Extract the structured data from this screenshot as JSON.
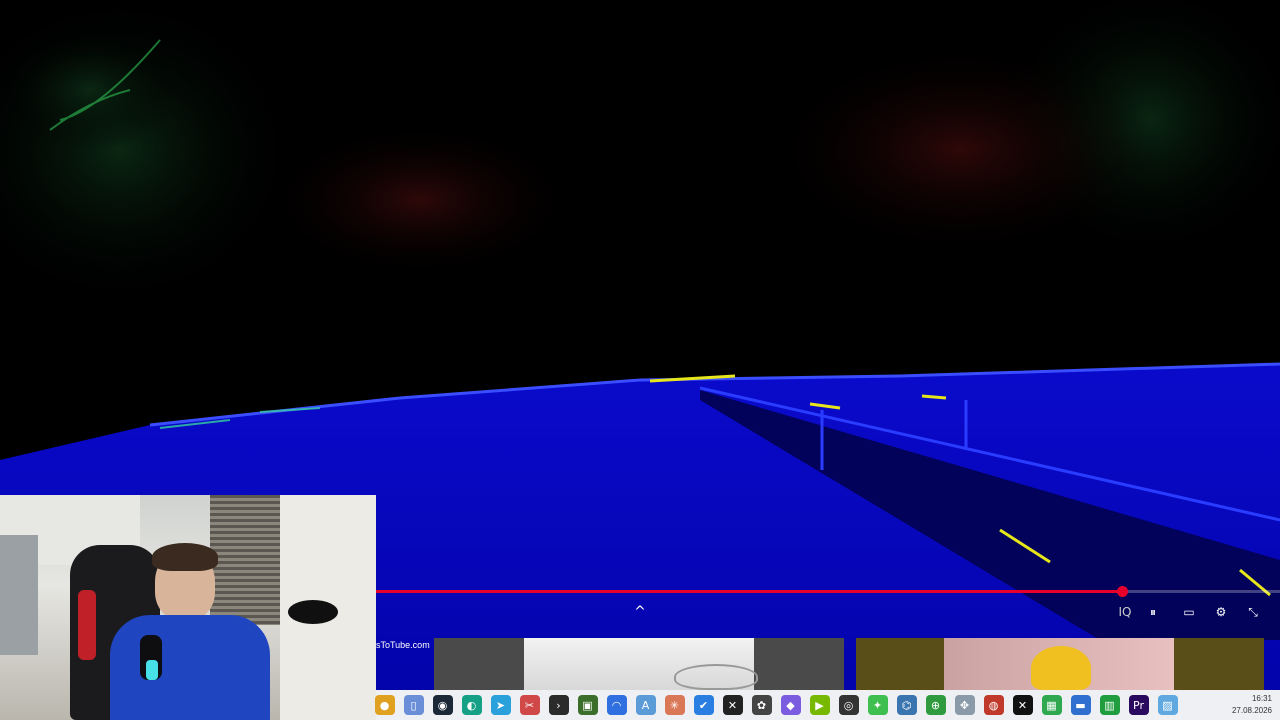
{
  "player": {
    "progress_fraction": 0.825,
    "controls": [
      {
        "name": "quality-badge-button",
        "glyph": "IQ",
        "color": "#cccccc"
      },
      {
        "name": "pause-button",
        "glyph": "⏸",
        "color": "#ffffff"
      },
      {
        "name": "subtitles-button",
        "glyph": "▭",
        "color": "#ffffff"
      },
      {
        "name": "settings-button",
        "glyph": "⚙",
        "color": "#ffffff"
      },
      {
        "name": "exit-fullscreen-button",
        "glyph": "⤡",
        "color": "#ffffff"
      }
    ],
    "expand_glyph": "^"
  },
  "cards": {
    "url_label": "sToTube.com"
  },
  "taskbar": {
    "icons": [
      {
        "name": "chrome-icon",
        "glyph": "●",
        "color": "#e0a020"
      },
      {
        "name": "file-icon",
        "glyph": "▯",
        "color": "#6a8fd8"
      },
      {
        "name": "steam-icon",
        "glyph": "◉",
        "color": "#1b2838"
      },
      {
        "name": "edge-icon",
        "glyph": "◐",
        "color": "#16a085"
      },
      {
        "name": "telegram-icon",
        "glyph": "➤",
        "color": "#2aa1da"
      },
      {
        "name": "snipping-tool-icon",
        "glyph": "✂",
        "color": "#d04848"
      },
      {
        "name": "terminal-icon",
        "glyph": "›",
        "color": "#2b2b2b"
      },
      {
        "name": "gpu-z-icon",
        "glyph": "▣",
        "color": "#3a6e2a"
      },
      {
        "name": "arc-icon",
        "glyph": "◠",
        "color": "#2f6fe0"
      },
      {
        "name": "atlas-icon",
        "glyph": "A",
        "color": "#5a9bd8"
      },
      {
        "name": "claude-icon",
        "glyph": "✳",
        "color": "#d97757"
      },
      {
        "name": "todo-icon",
        "glyph": "✔",
        "color": "#2a7de1"
      },
      {
        "name": "capcut-icon",
        "glyph": "✕",
        "color": "#222222"
      },
      {
        "name": "chatgpt-icon",
        "glyph": "✿",
        "color": "#444444"
      },
      {
        "name": "obsidian-icon",
        "glyph": "◆",
        "color": "#7b5ce0"
      },
      {
        "name": "nvidia-icon",
        "glyph": "▶",
        "color": "#76b900"
      },
      {
        "name": "obs-icon",
        "glyph": "◎",
        "color": "#333333"
      },
      {
        "name": "pin-icon",
        "glyph": "✦",
        "color": "#3fbf4f"
      },
      {
        "name": "python-icon",
        "glyph": "⌬",
        "color": "#3a75b0"
      },
      {
        "name": "globe-icon",
        "glyph": "⊕",
        "color": "#2f9a3e"
      },
      {
        "name": "puzzle-icon",
        "glyph": "✥",
        "color": "#8a9aa8"
      },
      {
        "name": "davinci-icon",
        "glyph": "◍",
        "color": "#c0392b"
      },
      {
        "name": "x-icon",
        "glyph": "✕",
        "color": "#111111"
      },
      {
        "name": "minecraft-icon",
        "glyph": "▦",
        "color": "#2fa84f"
      },
      {
        "name": "car-icon",
        "glyph": "▬",
        "color": "#2f6fd0"
      },
      {
        "name": "charts-icon",
        "glyph": "▥",
        "color": "#1f9d3f"
      },
      {
        "name": "premiere-icon",
        "glyph": "Pr",
        "color": "#2a0a5e"
      },
      {
        "name": "image-viewer-icon",
        "glyph": "▨",
        "color": "#5fa8e0"
      }
    ],
    "clock_time": "16:31",
    "clock_date": "27.08.2026"
  }
}
